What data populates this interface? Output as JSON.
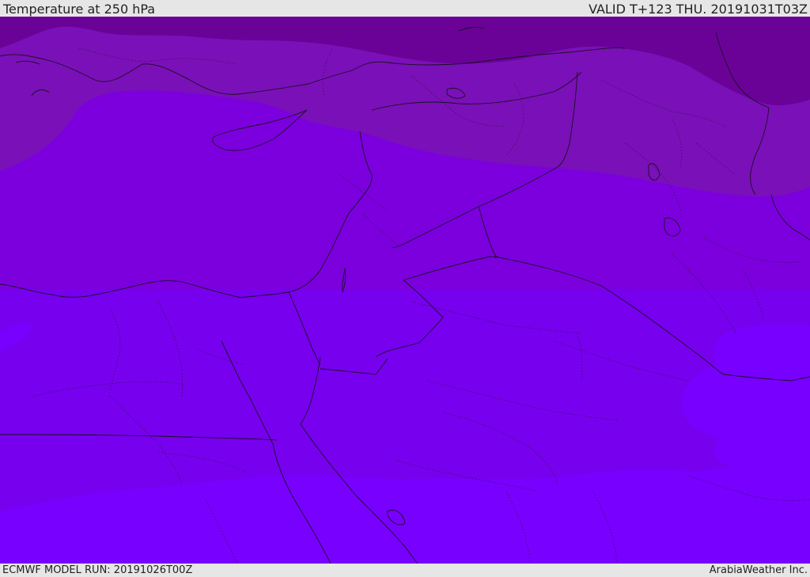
{
  "header": {
    "title": "Temperature at 250 hPa",
    "valid_time": "VALID T+123 THU. 20191031T03Z"
  },
  "footer": {
    "model_run": "ECMWF MODEL RUN: 20191026T00Z",
    "credit": "ArabiaWeather Inc."
  },
  "map": {
    "variable": "temperature",
    "level": "250 hPa",
    "colors": {
      "band_coldest": "#6a0298",
      "band_cold": "#7a10b8",
      "band_mid": "#7b00dd",
      "band_warm": "#7700ee",
      "band_warmest": "#7800ff",
      "coastline": "#1a1020",
      "border": "#1a1020"
    },
    "icons": [
      "coastline-layer",
      "country-border-layer",
      "region-border-layer"
    ]
  }
}
